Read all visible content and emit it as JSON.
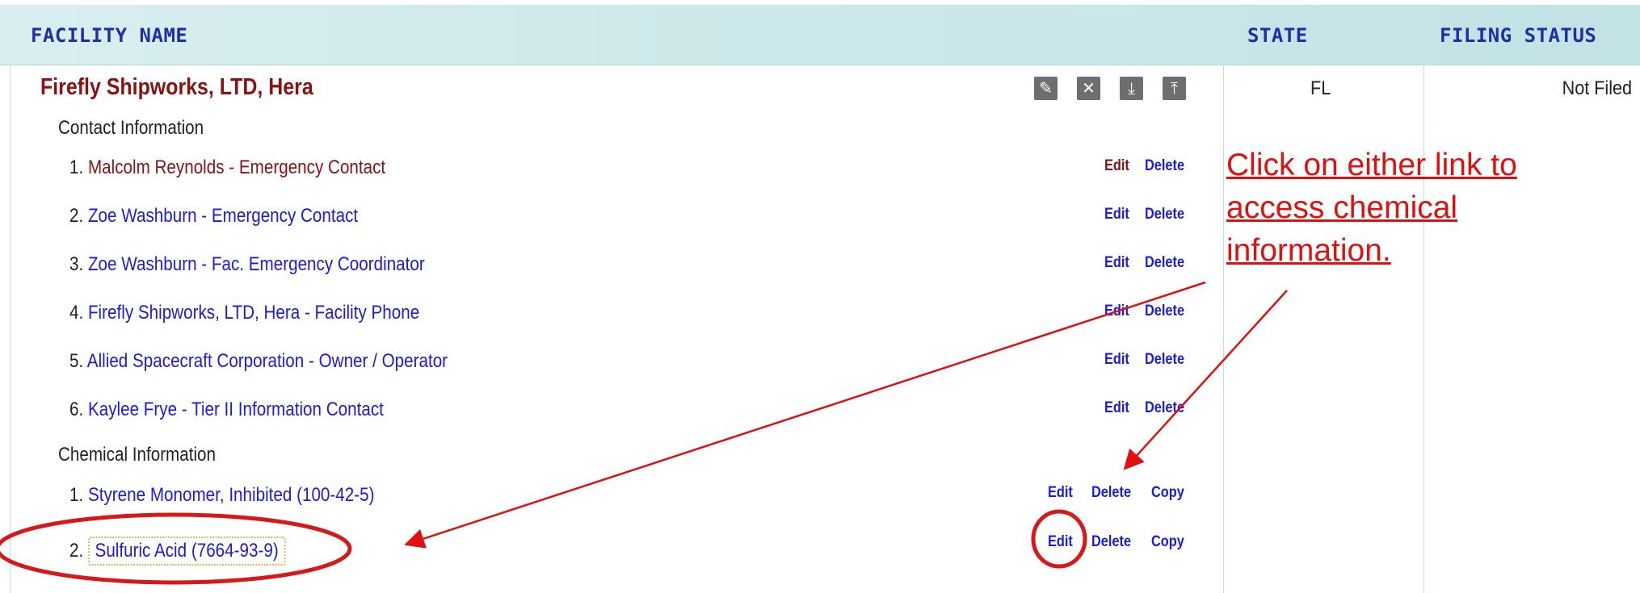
{
  "columns": {
    "facility_name": "FACILITY NAME",
    "state": "STATE",
    "filing_status": "FILING STATUS"
  },
  "facility": {
    "name": "Firefly Shipworks, LTD, Hera",
    "state": "FL",
    "filing_status": "Not Filed",
    "icons": [
      "edit-pencil-icon",
      "delete-x-icon",
      "download-icon",
      "upload-icon"
    ]
  },
  "contact_section": {
    "title": "Contact Information",
    "items": [
      {
        "num": "1.",
        "label": "Malcolm Reynolds - Emergency Contact",
        "edit": "Edit",
        "delete": "Delete"
      },
      {
        "num": "2.",
        "label": "Zoe Washburn - Emergency Contact",
        "edit": "Edit",
        "delete": "Delete"
      },
      {
        "num": "3.",
        "label": "Zoe Washburn - Fac. Emergency Coordinator",
        "edit": "Edit",
        "delete": "Delete"
      },
      {
        "num": "4.",
        "label": "Firefly Shipworks, LTD, Hera - Facility Phone",
        "edit": "Edit",
        "delete": "Delete"
      },
      {
        "num": "5.",
        "label": "Allied Spacecraft Corporation - Owner / Operator",
        "edit": "Edit",
        "delete": "Delete"
      },
      {
        "num": "6.",
        "label": "Kaylee Frye - Tier II Information Contact",
        "edit": "Edit",
        "delete": "Delete"
      }
    ]
  },
  "chemical_section": {
    "title": "Chemical Information",
    "items": [
      {
        "num": "1.",
        "label": "Styrene Monomer, Inhibited (100-42-5)",
        "edit": "Edit",
        "delete": "Delete",
        "copy": "Copy"
      },
      {
        "num": "2.",
        "label": "Sulfuric Acid (7664-93-9)",
        "edit": "Edit",
        "delete": "Delete",
        "copy": "Copy"
      }
    ]
  },
  "annotation": {
    "lines": [
      "Click on either link to",
      "access chemical",
      "information."
    ],
    "color": "#e01010"
  },
  "colors": {
    "header_bg": "#cde8ea",
    "header_text": "#1c2fa8",
    "facility_text": "#8b1212",
    "link": "#1a1ae6"
  }
}
